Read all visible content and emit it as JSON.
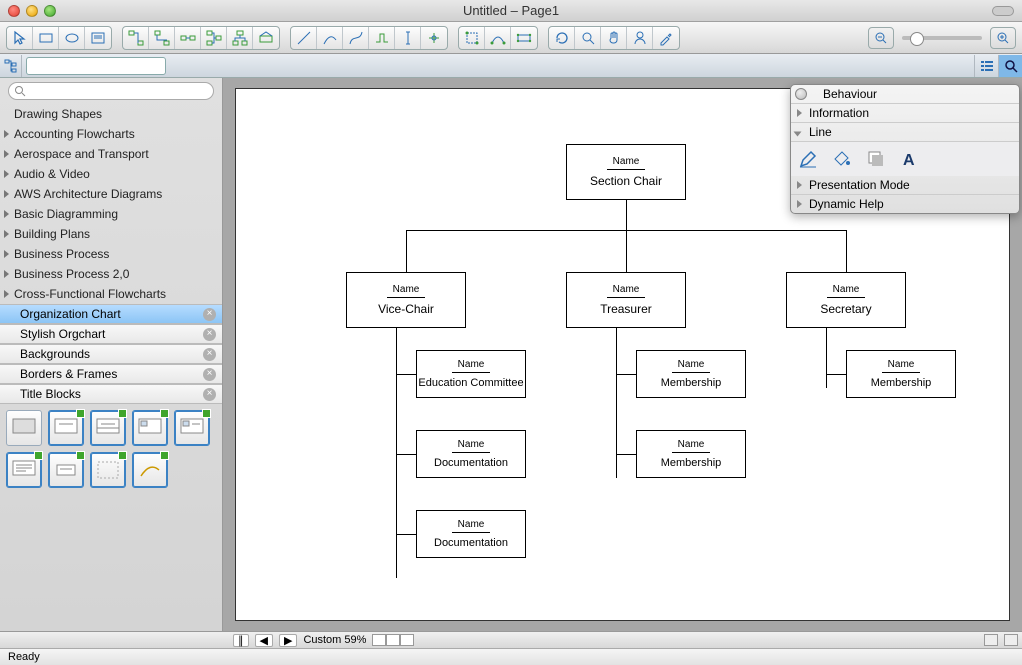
{
  "window": {
    "title": "Untitled – Page1"
  },
  "sidebar": {
    "search_placeholder": "",
    "heading": "Drawing Shapes",
    "categories": [
      "Accounting Flowcharts",
      "Aerospace and Transport",
      "Audio & Video",
      "AWS Architecture Diagrams",
      "Basic Diagramming",
      "Building Plans",
      "Business Process",
      "Business Process 2,0",
      "Cross-Functional Flowcharts"
    ],
    "subs": [
      {
        "label": "Organization Chart",
        "selected": true
      },
      {
        "label": "Stylish Orgchart",
        "selected": false
      },
      {
        "label": "Backgrounds",
        "selected": false
      },
      {
        "label": "Borders & Frames",
        "selected": false
      },
      {
        "label": "Title Blocks",
        "selected": false
      }
    ]
  },
  "shapes_count": 9,
  "org": {
    "root": {
      "name": "Name",
      "value": "Section Chair"
    },
    "level2": [
      {
        "name": "Name",
        "value": "Vice-Chair"
      },
      {
        "name": "Name",
        "value": "Treasurer"
      },
      {
        "name": "Name",
        "value": "Secretary"
      }
    ],
    "children": {
      "vice": [
        {
          "name": "Name",
          "value": "Education Committee"
        },
        {
          "name": "Name",
          "value": "Documentation"
        },
        {
          "name": "Name",
          "value": "Documentation"
        }
      ],
      "treas": [
        {
          "name": "Name",
          "value": "Membership"
        },
        {
          "name": "Name",
          "value": "Membership"
        }
      ],
      "sec": [
        {
          "name": "Name",
          "value": "Membership"
        }
      ]
    }
  },
  "panel": {
    "items": [
      "Behaviour",
      "Information",
      "Line",
      "Presentation Mode",
      "Dynamic Help"
    ]
  },
  "bottom": {
    "zoom_label": "Custom 59%"
  },
  "status": {
    "text": "Ready"
  }
}
